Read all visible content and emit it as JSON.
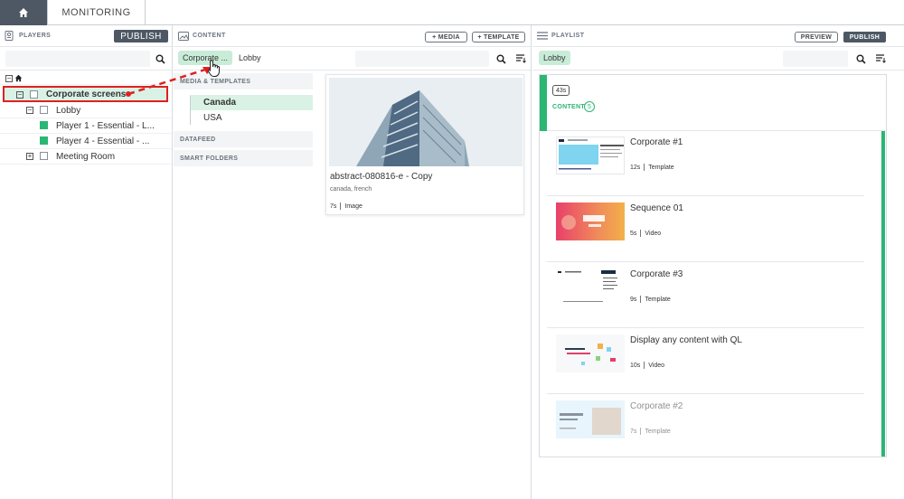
{
  "topbar": {
    "tab_label": "MONITORING"
  },
  "players": {
    "title": "PLAYERS",
    "publish_label": "PUBLISH",
    "tree": [
      {
        "label": "Corporate screens"
      },
      {
        "label": "Lobby"
      },
      {
        "label": "Player 1 - Essential - L..."
      },
      {
        "label": "Player 4 - Essential - ..."
      },
      {
        "label": "Meeting Room"
      }
    ]
  },
  "content": {
    "title": "CONTENT",
    "media_button": "+ MEDIA",
    "template_button": "+ TEMPLATE",
    "breadcrumb": [
      "Corporate ...",
      "Lobby"
    ],
    "sections": {
      "media_templates": "MEDIA & TEMPLATES",
      "datafeed": "DATAFEED",
      "smart_folders": "SMART FOLDERS"
    },
    "subitems": [
      "Canada",
      "USA"
    ],
    "card": {
      "name": "abstract-080816-e - Copy",
      "tags": "canada, french",
      "duration": "7s",
      "type": "Image"
    }
  },
  "playlist": {
    "title": "PLAYLIST",
    "preview_label": "PREVIEW",
    "publish_label": "PUBLISH",
    "filter_chip": "Lobby",
    "total_duration": "43s",
    "content_label": "CONTENT",
    "content_count": "5",
    "items": [
      {
        "name": "Corporate #1",
        "duration": "12s",
        "type": "Template"
      },
      {
        "name": "Sequence 01",
        "duration": "5s",
        "type": "Video"
      },
      {
        "name": "Corporate #3",
        "duration": "9s",
        "type": "Template"
      },
      {
        "name": "Display any content with QL",
        "duration": "10s",
        "type": "Video"
      },
      {
        "name": "Corporate #2",
        "duration": "7s",
        "type": "Template"
      }
    ]
  },
  "colors": {
    "dark": "#4d5864",
    "accent_green": "#2bb673",
    "chip_green": "#c9ecd8",
    "highlight_red": "#e02020"
  }
}
